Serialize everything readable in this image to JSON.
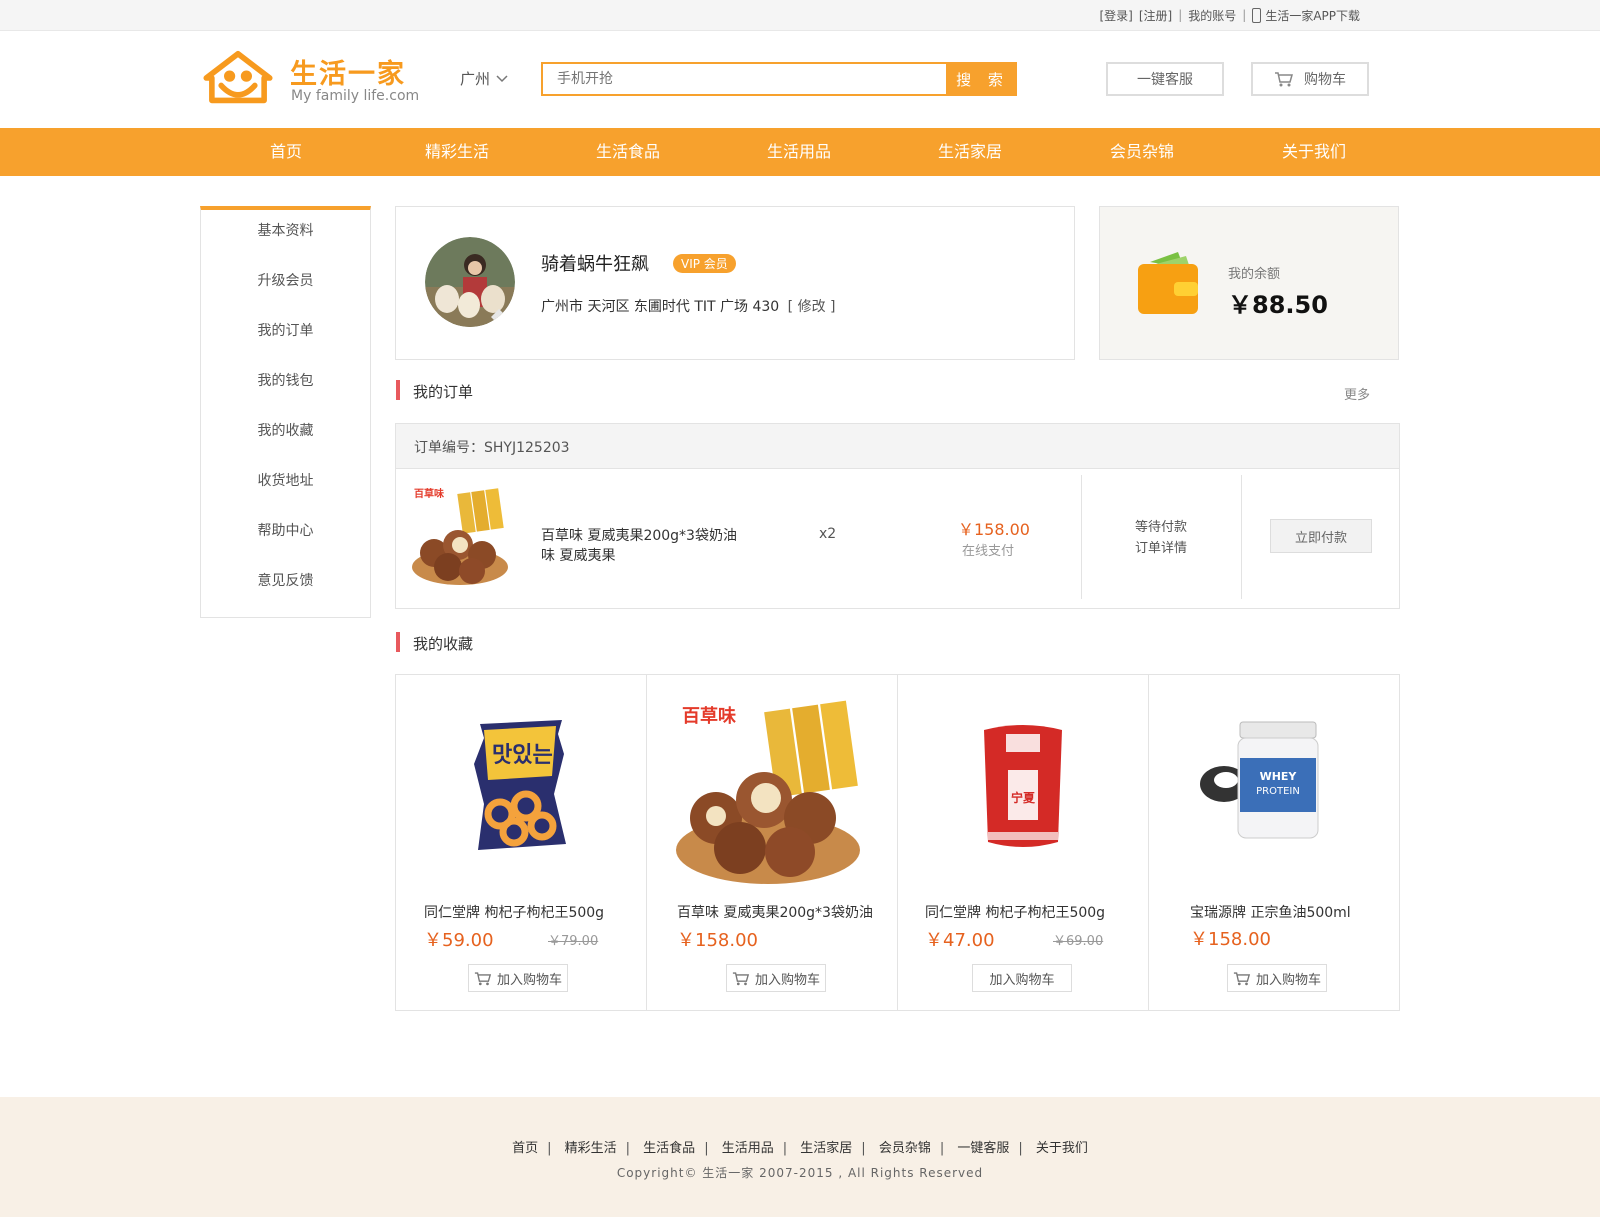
{
  "topbar": {
    "login": "[登录]",
    "register": "[注册]",
    "account": "我的账号",
    "sep": "|",
    "app_download": "生活一家APP下载"
  },
  "header": {
    "logo_title": "生活一家",
    "logo_subtitle": "My family life.com",
    "city": "广州",
    "search_placeholder": "手机开抢",
    "search_button": "搜 索",
    "service_button": "一键客服",
    "cart_button": "购物车"
  },
  "nav": [
    "首页",
    "精彩生活",
    "生活食品",
    "生活用品",
    "生活家居",
    "会员杂锦",
    "关于我们"
  ],
  "sidebar": [
    "基本资料",
    "升级会员",
    "我的订单",
    "我的钱包",
    "我的收藏",
    "收货地址",
    "帮助中心",
    "意见反馈"
  ],
  "profile": {
    "username": "骑着蜗牛狂飙",
    "vip_badge": "VIP 会员",
    "address": "广州市 天河区 东圃时代 TIT 广场 430",
    "edit_link": "[ 修改 ]"
  },
  "wallet": {
    "label": "我的余额",
    "balance": "￥88.50"
  },
  "orders": {
    "title": "我的订单",
    "more": "更多",
    "order_no": "订单编号：SHYJ125203",
    "item_name": "百草味 夏威夷果200g*3袋奶油味  夏威夷果",
    "quantity": "x2",
    "price": "￥158.00",
    "pay_method": "在线支付",
    "status": "等待付款",
    "detail_link": "订单详情",
    "pay_button": "立即付款"
  },
  "favorites": {
    "title": "我的收藏",
    "add_to_cart": "加入购物车",
    "items": [
      {
        "name": "同仁堂牌  枸杞子枸杞王500g",
        "price": "￥59.00",
        "old_price": "￥79.00"
      },
      {
        "name": "百草味 夏威夷果200g*3袋奶油",
        "price": "￥158.00",
        "old_price": ""
      },
      {
        "name": "同仁堂牌  枸杞子枸杞王500g",
        "price": "￥47.00",
        "old_price": "￥69.00"
      },
      {
        "name": "宝瑞源牌  正宗鱼油500ml",
        "price": "￥158.00",
        "old_price": ""
      }
    ]
  },
  "footer": {
    "links": [
      "首页",
      "精彩生活",
      "生活食品",
      "生活用品",
      "生活家居",
      "会员杂锦",
      "一键客服",
      "关于我们"
    ],
    "copyright": "Copyright© 生活一家 2007-2015 , All Rights Reserved"
  },
  "colors": {
    "brand": "#f7a12d",
    "price": "#e6621f",
    "section_bar": "#e8595d"
  }
}
